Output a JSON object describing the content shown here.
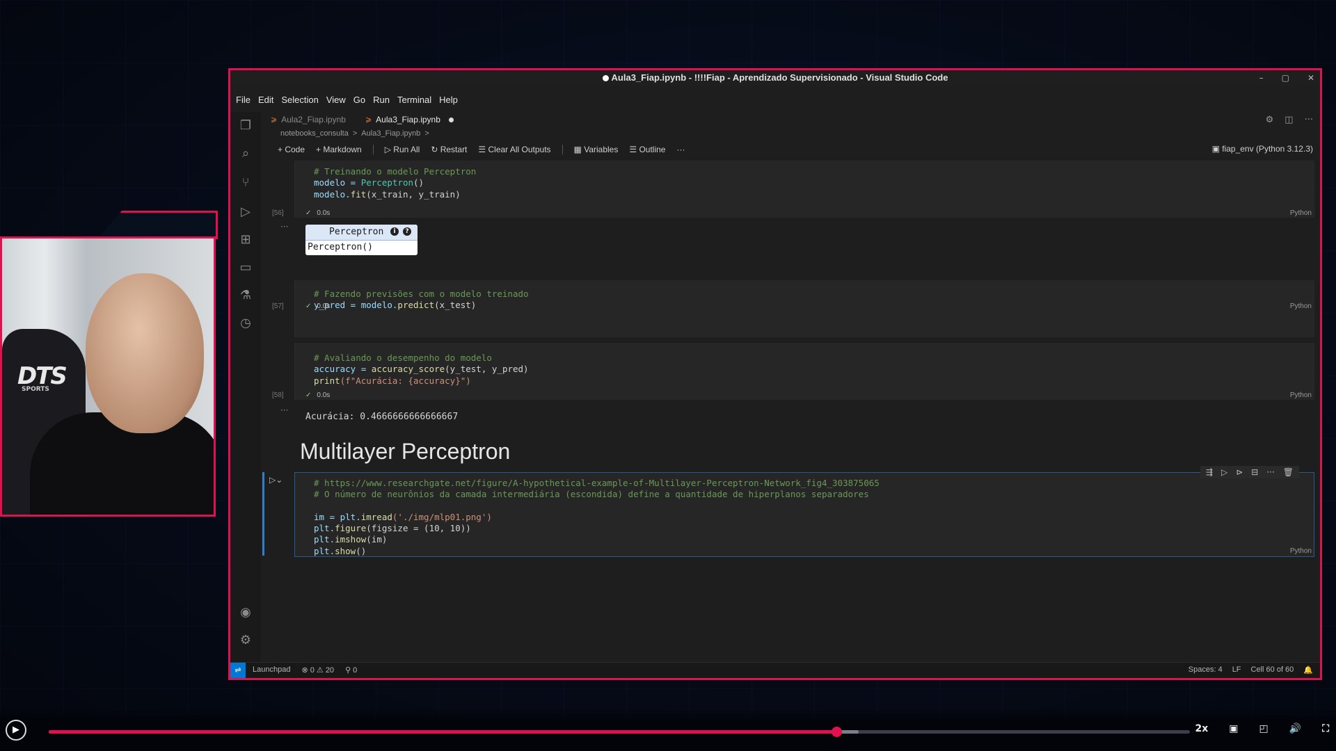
{
  "window": {
    "title": "Aula3_Fiap.ipynb - !!!!Fiap - Aprendizado Supervisionado - Visual Studio Code",
    "controls": [
      "–",
      "▢",
      "✕"
    ]
  },
  "menu": [
    "File",
    "Edit",
    "Selection",
    "View",
    "Go",
    "Run",
    "Terminal",
    "Help"
  ],
  "tabs": [
    {
      "label": "Aula2_Fiap.ipynb",
      "active": false
    },
    {
      "label": "Aula3_Fiap.ipynb",
      "active": true,
      "dirty": true
    }
  ],
  "breadcrumb": [
    "notebooks_consulta",
    ">",
    "Aula3_Fiap.ipynb",
    ">"
  ],
  "toolbar": {
    "code": "+ Code",
    "markdown": "+ Markdown",
    "run_all": "▷ Run All",
    "restart": "↻ Restart",
    "clear": "☰ Clear All Outputs",
    "variables": "▦ Variables",
    "outline": "☰ Outline",
    "more": "···",
    "kernel": "fiap_env (Python 3.12.3)"
  },
  "cells": {
    "c56": {
      "exec": "[56]",
      "line1": "# Treinando o modelo Perceptron",
      "line2a": "modelo = ",
      "line2b": "Perceptron",
      "line2c": "()",
      "line3a": "modelo.",
      "line3b": "fit",
      "line3c": "(x_train, y_train)",
      "time": "0.0s",
      "lang": "Python",
      "widget_title": "Perceptron",
      "widget_body": "Perceptron()",
      "widget_i1": "i",
      "widget_i2": "?"
    },
    "c57": {
      "exec": "[57]",
      "line1": "# Fazendo previsões com o modelo treinado",
      "line2a": "y_pred = modelo.",
      "line2b": "predict",
      "line2c": "(x_test)",
      "time": "0.0s",
      "lang": "Python"
    },
    "c58": {
      "exec": "[58]",
      "line1": "# Avaliando o desempenho do modelo",
      "line2a": "accuracy = ",
      "line2b": "accuracy_score",
      "line2c": "(y_test, y_pred)",
      "line3a": "print",
      "line3b": "(f\"Acurácia: {accuracy}\")",
      "time": "0.0s",
      "lang": "Python",
      "output": "Acurácia: 0.4666666666666667"
    },
    "markdown_heading": "Multilayer Perceptron",
    "c_active": {
      "line1": "# https://www.researchgate.net/figure/A-hypothetical-example-of-Multilayer-Perceptron-Network_fig4_303875065",
      "line2": "# O número de neurônios da camada intermediária (escondida) define a quantidade de hiperplanos separadores",
      "line4a": "im = plt.",
      "line4b": "imread",
      "line4c": "('./img/mlp01.png')",
      "line5a": "plt.",
      "line5b": "figure",
      "line5c": "(figsize = (10, 10))",
      "line6a": "plt.",
      "line6b": "imshow",
      "line6c": "(im)",
      "line7a": "plt.",
      "line7b": "show",
      "line7c": "()",
      "lang": "Python"
    }
  },
  "statusbar": {
    "remote": "⇌",
    "launchpad": "Launchpad",
    "problems": "⊗ 0 ⚠ 20",
    "ports": "⚲ 0",
    "spaces": "Spaces: 4",
    "eol": "LF",
    "cell": "Cell 60 of 60"
  },
  "webcam": {
    "chair_logo": "DTS",
    "chair_sub": "SPORTS"
  },
  "player": {
    "progress": 0.69,
    "buffered": 0.71,
    "speed": "2x"
  }
}
